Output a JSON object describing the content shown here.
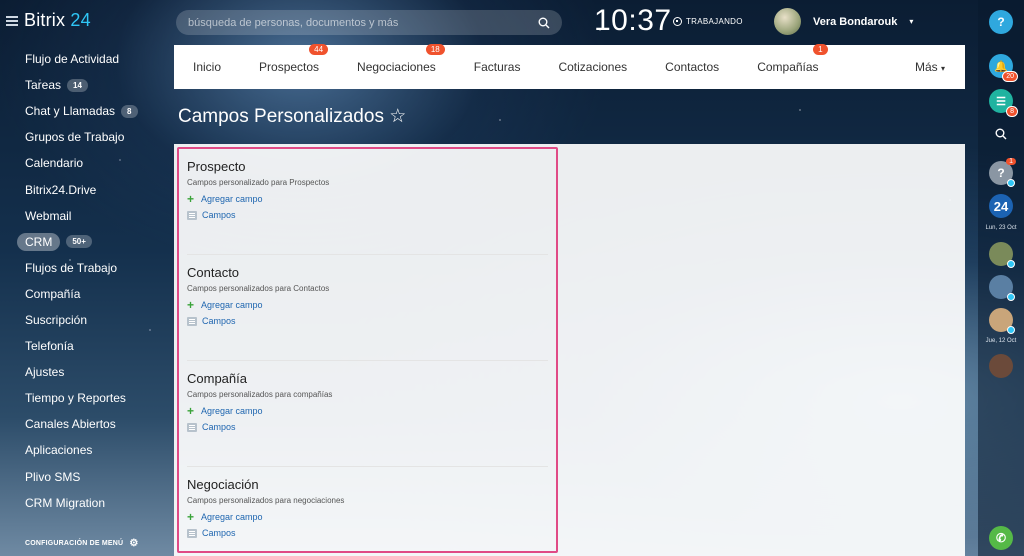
{
  "app": {
    "logo_name": "Bitrix",
    "logo_num": "24"
  },
  "sidebar": {
    "items": [
      {
        "label": "Flujo de Actividad"
      },
      {
        "label": "Tareas",
        "badge": "14"
      },
      {
        "label": "Chat y Llamadas",
        "badge": "8"
      },
      {
        "label": "Grupos de Trabajo"
      },
      {
        "label": "Calendario"
      },
      {
        "label": "Bitrix24.Drive"
      },
      {
        "label": "Webmail"
      },
      {
        "label": "CRM",
        "badge": "50+"
      },
      {
        "label": "Flujos de Trabajo"
      },
      {
        "label": "Compañía"
      },
      {
        "label": "Suscripción"
      },
      {
        "label": "Telefonía"
      },
      {
        "label": "Ajustes"
      },
      {
        "label": "Tiempo y Reportes"
      },
      {
        "label": "Canales Abiertos"
      },
      {
        "label": "Aplicaciones"
      },
      {
        "label": "Plivo SMS"
      },
      {
        "label": "CRM Migration"
      }
    ],
    "config_label": "CONFIGURACIÓN DE MENÚ"
  },
  "header": {
    "search_placeholder": "búsqueda de personas, documentos y más",
    "clock": "10:37",
    "work_status": "TRABAJANDO",
    "user_name": "Vera Bondarouk"
  },
  "tabs": [
    {
      "label": "Inicio",
      "badge": ""
    },
    {
      "label": "Prospectos",
      "badge": "44"
    },
    {
      "label": "Negociaciones",
      "badge": "18"
    },
    {
      "label": "Facturas",
      "badge": ""
    },
    {
      "label": "Cotizaciones",
      "badge": ""
    },
    {
      "label": "Contactos",
      "badge": ""
    },
    {
      "label": "Compañías",
      "badge": "1"
    }
  ],
  "tabs_more": "Más",
  "page": {
    "title": "Campos Personalizados",
    "star": "☆"
  },
  "sections": [
    {
      "title": "Prospecto",
      "desc": "Campos personalizado para Prospectos",
      "add": "Agregar campo",
      "fields": "Campos"
    },
    {
      "title": "Contacto",
      "desc": "Campos personalizados para Contactos",
      "add": "Agregar campo",
      "fields": "Campos"
    },
    {
      "title": "Compañía",
      "desc": "Campos personalizados para compañías",
      "add": "Agregar campo",
      "fields": "Campos"
    },
    {
      "title": "Negociación",
      "desc": "Campos personalizados para negociaciones",
      "add": "Agregar campo",
      "fields": "Campos"
    }
  ],
  "rightbar": {
    "help": "?",
    "notifications_badge": "20",
    "chat_badge": "8",
    "unknown_badge": "1",
    "b24": "24",
    "date1": "Lun, 23 Oct",
    "date2": "Jue, 12 Oct"
  },
  "colors": {
    "accent": "#2fc6f6",
    "badge": "#f0522d",
    "highlight": "#e04a86"
  }
}
